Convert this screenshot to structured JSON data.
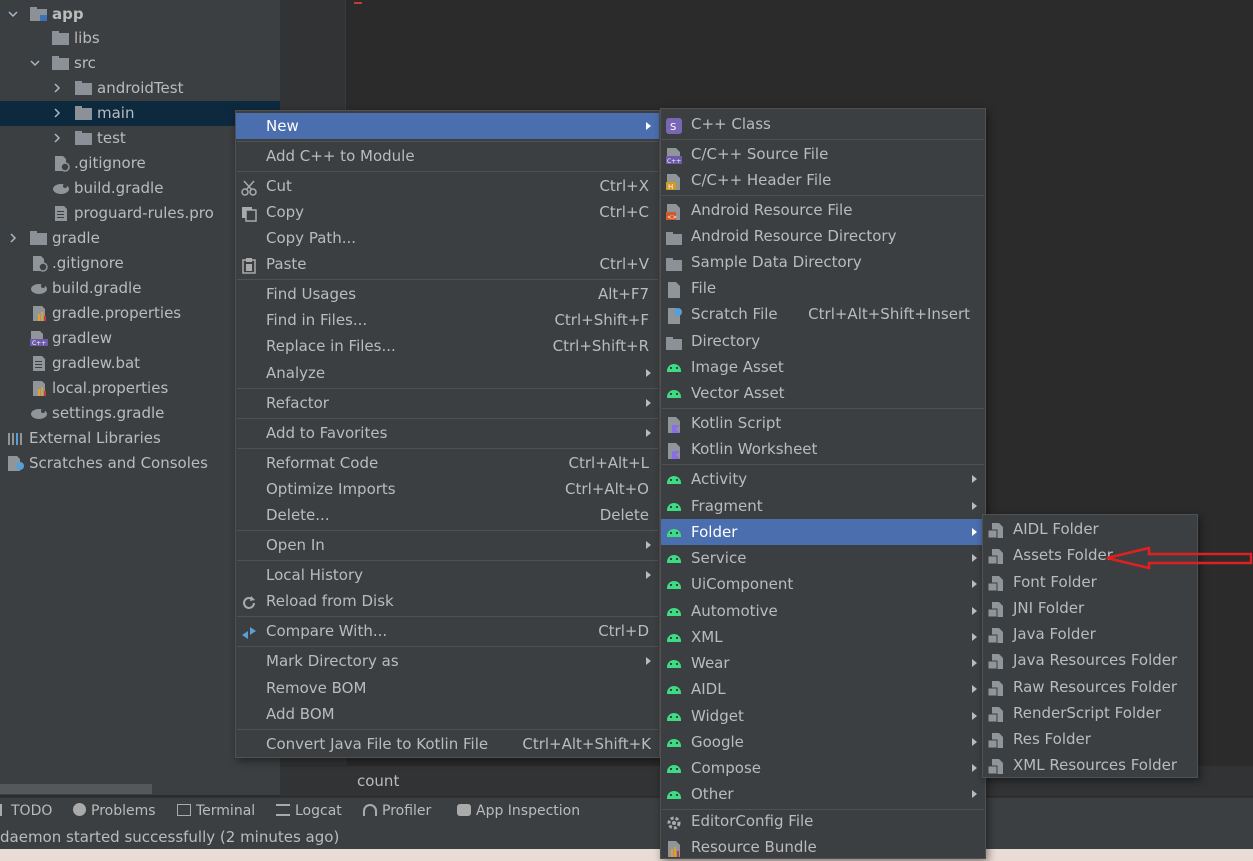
{
  "project_tree": {
    "items": [
      {
        "label": "app",
        "bold": true
      },
      {
        "label": "libs"
      },
      {
        "label": "src"
      },
      {
        "label": "androidTest"
      },
      {
        "label": "main",
        "selected": true
      },
      {
        "label": "test"
      },
      {
        "label": ".gitignore"
      },
      {
        "label": "build.gradle"
      },
      {
        "label": "proguard-rules.pro"
      },
      {
        "label": "gradle"
      },
      {
        "label": ".gitignore"
      },
      {
        "label": "build.gradle"
      },
      {
        "label": "gradle.properties"
      },
      {
        "label": "gradlew"
      },
      {
        "label": "gradlew.bat"
      },
      {
        "label": "local.properties"
      },
      {
        "label": "settings.gradle"
      },
      {
        "label": "External Libraries"
      },
      {
        "label": "Scratches and Consoles"
      }
    ]
  },
  "editor": {
    "bottom_text": "count"
  },
  "tool_windows": {
    "todo": "TODO",
    "problems": "Problems",
    "terminal": "Terminal",
    "logcat": "Logcat",
    "profiler": "Profiler",
    "app_inspection": "App Inspection"
  },
  "status_bar": {
    "message": "daemon started successfully (2 minutes ago)"
  },
  "context_menu": {
    "items": [
      {
        "label": "New",
        "submenu": true,
        "highlighted": true
      },
      {
        "label": "Add C++ to Module"
      },
      {
        "label": "Cut",
        "shortcut": "Ctrl+X"
      },
      {
        "label": "Copy",
        "shortcut": "Ctrl+C"
      },
      {
        "label": "Copy Path..."
      },
      {
        "label": "Paste",
        "shortcut": "Ctrl+V"
      },
      {
        "label": "Find Usages",
        "shortcut": "Alt+F7"
      },
      {
        "label": "Find in Files...",
        "shortcut": "Ctrl+Shift+F"
      },
      {
        "label": "Replace in Files...",
        "shortcut": "Ctrl+Shift+R"
      },
      {
        "label": "Analyze",
        "submenu": true
      },
      {
        "label": "Refactor",
        "submenu": true
      },
      {
        "label": "Add to Favorites",
        "submenu": true
      },
      {
        "label": "Reformat Code",
        "shortcut": "Ctrl+Alt+L"
      },
      {
        "label": "Optimize Imports",
        "shortcut": "Ctrl+Alt+O"
      },
      {
        "label": "Delete...",
        "shortcut": "Delete"
      },
      {
        "label": "Open In",
        "submenu": true
      },
      {
        "label": "Local History",
        "submenu": true
      },
      {
        "label": "Reload from Disk"
      },
      {
        "label": "Compare With...",
        "shortcut": "Ctrl+D"
      },
      {
        "label": "Mark Directory as",
        "submenu": true
      },
      {
        "label": "Remove BOM"
      },
      {
        "label": "Add BOM"
      },
      {
        "label": "Convert Java File to Kotlin File",
        "shortcut": "Ctrl+Alt+Shift+K"
      }
    ]
  },
  "new_menu": {
    "items": [
      {
        "label": "C++ Class"
      },
      {
        "label": "C/C++ Source File"
      },
      {
        "label": "C/C++ Header File"
      },
      {
        "label": "Android Resource File"
      },
      {
        "label": "Android Resource Directory"
      },
      {
        "label": "Sample Data Directory"
      },
      {
        "label": "File"
      },
      {
        "label": "Scratch File",
        "shortcut": "Ctrl+Alt+Shift+Insert"
      },
      {
        "label": "Directory"
      },
      {
        "label": "Image Asset"
      },
      {
        "label": "Vector Asset"
      },
      {
        "label": "Kotlin Script"
      },
      {
        "label": "Kotlin Worksheet"
      },
      {
        "label": "Activity",
        "submenu": true
      },
      {
        "label": "Fragment",
        "submenu": true
      },
      {
        "label": "Folder",
        "submenu": true,
        "highlighted": true
      },
      {
        "label": "Service",
        "submenu": true
      },
      {
        "label": "UiComponent",
        "submenu": true
      },
      {
        "label": "Automotive",
        "submenu": true
      },
      {
        "label": "XML",
        "submenu": true
      },
      {
        "label": "Wear",
        "submenu": true
      },
      {
        "label": "AIDL",
        "submenu": true
      },
      {
        "label": "Widget",
        "submenu": true
      },
      {
        "label": "Google",
        "submenu": true
      },
      {
        "label": "Compose",
        "submenu": true
      },
      {
        "label": "Other",
        "submenu": true
      },
      {
        "label": "EditorConfig File"
      },
      {
        "label": "Resource Bundle"
      }
    ],
    "cpp_class_badge": "S"
  },
  "folder_menu": {
    "items": [
      {
        "label": "AIDL Folder"
      },
      {
        "label": "Assets Folder"
      },
      {
        "label": "Font Folder"
      },
      {
        "label": "JNI Folder"
      },
      {
        "label": "Java Folder"
      },
      {
        "label": "Java Resources Folder"
      },
      {
        "label": "Raw Resources Folder"
      },
      {
        "label": "RenderScript Folder"
      },
      {
        "label": "Res Folder"
      },
      {
        "label": "XML Resources Folder"
      }
    ]
  },
  "annotation": {
    "arrow_color": "#e02020",
    "points_to": "Assets Folder"
  },
  "colors": {
    "highlight": "#4b6eaf",
    "background": "#3c3f41",
    "android_green": "#3ddc84"
  }
}
